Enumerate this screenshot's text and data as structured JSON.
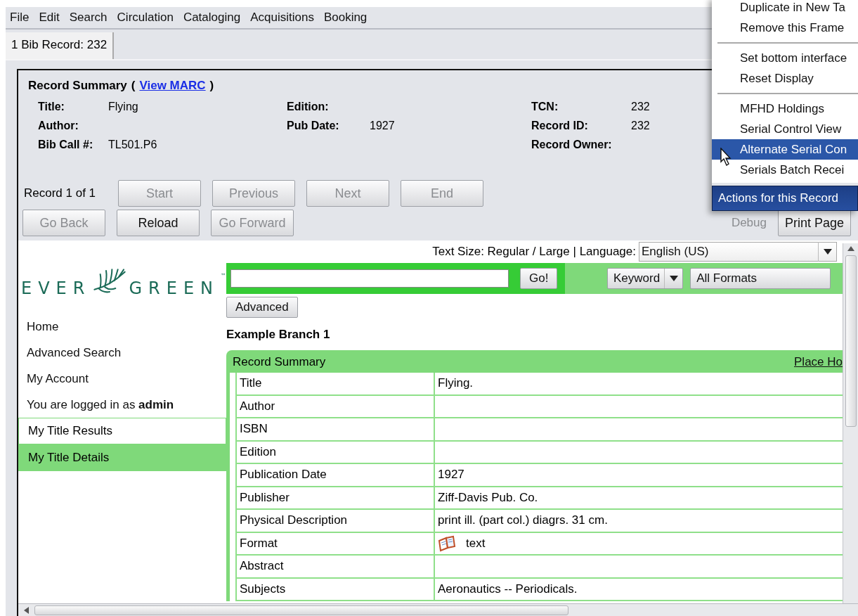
{
  "menu_bar": [
    "File",
    "Edit",
    "Search",
    "Circulation",
    "Cataloging",
    "Acquisitions",
    "Booking"
  ],
  "tabs": [
    {
      "label": "1 Bib Record: 232",
      "selected": true
    }
  ],
  "record_summary": {
    "heading": "Record Summary",
    "open_paren": "(",
    "link": "View MARC",
    "close_paren": ")",
    "columns": [
      [
        {
          "label": "Title:",
          "value": "Flying"
        },
        {
          "label": "Author:"
        },
        {
          "label": "Bib Call #:",
          "value": "TL501.P6"
        }
      ],
      [
        {
          "label": "Edition:"
        },
        {
          "label": "Pub Date:",
          "value": "1927"
        }
      ],
      [
        {
          "label": "TCN:",
          "value": "232"
        },
        {
          "label": "Record ID:",
          "value": "232"
        },
        {
          "label": "Record Owner:"
        }
      ]
    ]
  },
  "navigation": {
    "position": "Record 1 of 1",
    "buttons": [
      {
        "label": "Start",
        "disabled": true
      },
      {
        "label": "Previous",
        "disabled": true
      },
      {
        "label": "Next",
        "disabled": true
      },
      {
        "label": "End",
        "disabled": true
      }
    ],
    "history_buttons": [
      {
        "label": "Go Back",
        "disabled": true
      },
      {
        "label": "Reload",
        "disabled": false
      },
      {
        "label": "Go Forward",
        "disabled": true
      }
    ],
    "debug": {
      "label": "Debug",
      "disabled": true
    },
    "print_button": "Print Page"
  },
  "actions_menu": {
    "button": "Actions for this Record",
    "groups": [
      [
        {
          "label": "Duplicate in New Ta",
          "selected": false
        },
        {
          "label": "Remove this Frame",
          "selected": false
        }
      ],
      [
        {
          "label": "Set bottom interface",
          "selected": false
        },
        {
          "label": "Reset Display",
          "selected": false
        }
      ],
      [
        {
          "label": "MFHD Holdings",
          "selected": false
        },
        {
          "label": "Serial Control View",
          "selected": false
        },
        {
          "label": "Alternate Serial Con",
          "selected": true
        },
        {
          "label": "Serials Batch Recei",
          "selected": false
        }
      ]
    ]
  },
  "opac": {
    "text_size": "Text Size: Regular / Large | Language:",
    "language": "English (US)",
    "logo": {
      "left": "EVER",
      "right": "GREEN",
      "mark": "™"
    },
    "search": {
      "go": "Go!",
      "type": "Keyword",
      "format": "All Formats",
      "advanced": "Advanced"
    },
    "sidebar": {
      "links": [
        "Home",
        "Advanced Search",
        "My Account",
        "You are logged in as **admin**"
      ],
      "tabs": [
        {
          "label": "My Title Results",
          "selected": false
        },
        {
          "label": "My Title Details",
          "selected": true
        }
      ]
    },
    "branch": "Example Branch 1",
    "table": {
      "title": "Record Summary",
      "place_hold": "Place Ho",
      "rows": [
        {
          "label": "Title",
          "value": "Flying."
        },
        {
          "label": "Author"
        },
        {
          "label": "ISBN"
        },
        {
          "label": "Edition"
        },
        {
          "label": "Publication Date",
          "value": "1927"
        },
        {
          "label": "Publisher",
          "value": "Ziff-Davis Pub. Co."
        },
        {
          "label": "Physical Description",
          "value": "print ill. (part col.) diagrs. 31 cm."
        },
        {
          "label": "Format",
          "value": "text",
          "kind": "format"
        },
        {
          "label": "Abstract"
        },
        {
          "label": "Subjects",
          "value": "Aeronautics -- Periodicals."
        }
      ]
    }
  }
}
